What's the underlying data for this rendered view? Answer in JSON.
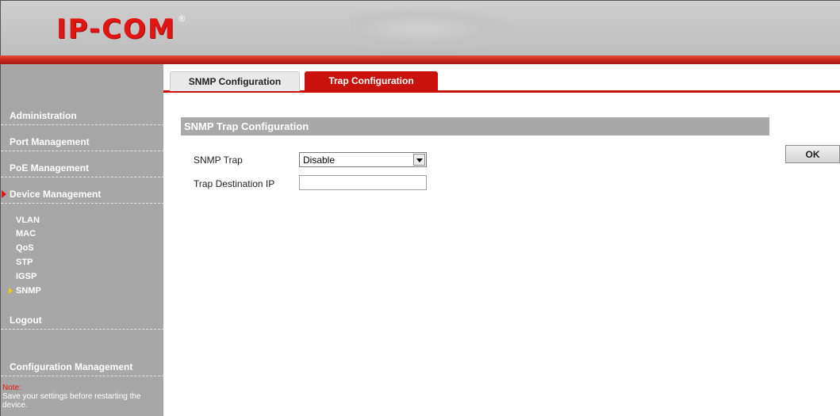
{
  "header": {
    "logo_text": "IP-COM",
    "logo_mark": "®"
  },
  "sidebar": {
    "items": [
      {
        "label": "Administration"
      },
      {
        "label": "Port Management"
      },
      {
        "label": "PoE Management"
      },
      {
        "label": "Device Management",
        "active": true
      }
    ],
    "subitems": [
      {
        "label": "VLAN"
      },
      {
        "label": "MAC"
      },
      {
        "label": "QoS"
      },
      {
        "label": "STP"
      },
      {
        "label": "IGSP"
      },
      {
        "label": "SNMP",
        "active": true
      }
    ],
    "logout_label": "Logout",
    "config_mgmt_label": "Configuration Management",
    "note_title": "Note:",
    "note_text": "Save your settings before restarting the device."
  },
  "tabs": [
    {
      "label": "SNMP Configuration",
      "active": false
    },
    {
      "label": "Trap Configuration",
      "active": true
    }
  ],
  "main": {
    "section_title": "SNMP Trap Configuration",
    "snmp_trap_label": "SNMP Trap",
    "snmp_trap_value": "Disable",
    "trap_dest_label": "Trap Destination IP",
    "trap_dest_value": ""
  },
  "actions": {
    "ok_label": "OK"
  },
  "colors": {
    "accent_red": "#c8120b",
    "sidebar_gray": "#a7a7a7",
    "active_arrow_yellow": "#f5d000"
  }
}
